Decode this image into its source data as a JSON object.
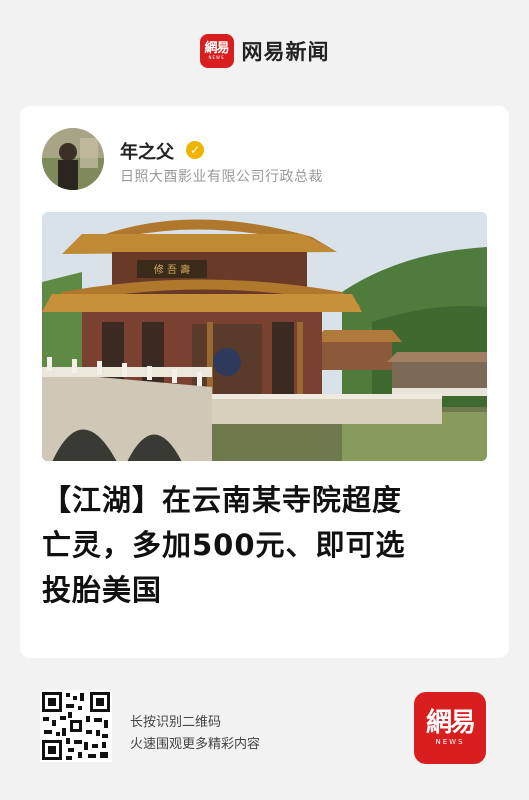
{
  "brand": {
    "logo_zh": "網易",
    "logo_en": "NEWS",
    "name": "网易新闻",
    "color": "#d81e1e"
  },
  "card": {
    "author": {
      "name": "年之父",
      "verified_icon": "verified-badge-icon",
      "title": "日照大酉影业有限公司行政总裁"
    },
    "photo": {
      "plaque_text": "修 吾 壽"
    },
    "headline": [
      "【江湖】在云南某寺院超度",
      "亡灵，多加500元、即可选",
      "投胎美国"
    ]
  },
  "footer": {
    "qr_icon": "qr-code-icon",
    "hint_line1": "长按识别二维码",
    "hint_line2": "火速围观更多精彩内容",
    "logo_zh": "網易",
    "logo_en": "NEWS"
  }
}
